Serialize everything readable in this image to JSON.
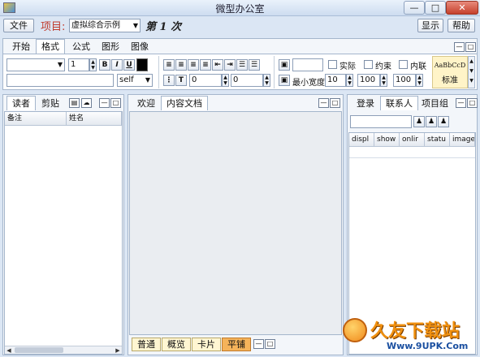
{
  "app": {
    "title": "微型办公室",
    "window_buttons": [
      "—",
      "□",
      "✕"
    ]
  },
  "toolbar": {
    "file": "文件",
    "project_label": "项目:",
    "project_value": "虚拟综合示例",
    "session": "第 1 次",
    "display": "显示",
    "help": "帮助"
  },
  "ribbon": {
    "tabs": [
      "开始",
      "格式",
      "公式",
      "图形",
      "图像"
    ],
    "active_tab": 1,
    "font_size": "1",
    "format_buttons": [
      "B",
      "I",
      "U"
    ],
    "dropdown2_value": "self",
    "indent1": "0",
    "indent2": "0",
    "min_width_label": "最小宽度",
    "min_width": "10",
    "val2": "100",
    "val3": "100",
    "checks": [
      "实际",
      "约束",
      "内联"
    ],
    "style_preview": "AaBbCcD",
    "style_name": "标准"
  },
  "left_panel": {
    "tabs": [
      "读者",
      "剪贴"
    ],
    "columns": [
      "备注",
      "姓名"
    ]
  },
  "center_panel": {
    "tabs": [
      "欢迎",
      "内容文档"
    ],
    "view_tabs": [
      "普通",
      "概览",
      "卡片",
      "平铺"
    ],
    "active_view": 3
  },
  "right_panel": {
    "tabs": [
      "登录",
      "联系人",
      "项目组"
    ],
    "columns": [
      "displ",
      "show",
      "onlir",
      "statu",
      "image"
    ]
  },
  "watermark": {
    "brand": "久友下载站",
    "url": "Www.9UPK.Com"
  },
  "colors": {
    "accent": "#f5b35a",
    "active_view_tab": "#f5b35a",
    "project_label": "#c0392b"
  }
}
